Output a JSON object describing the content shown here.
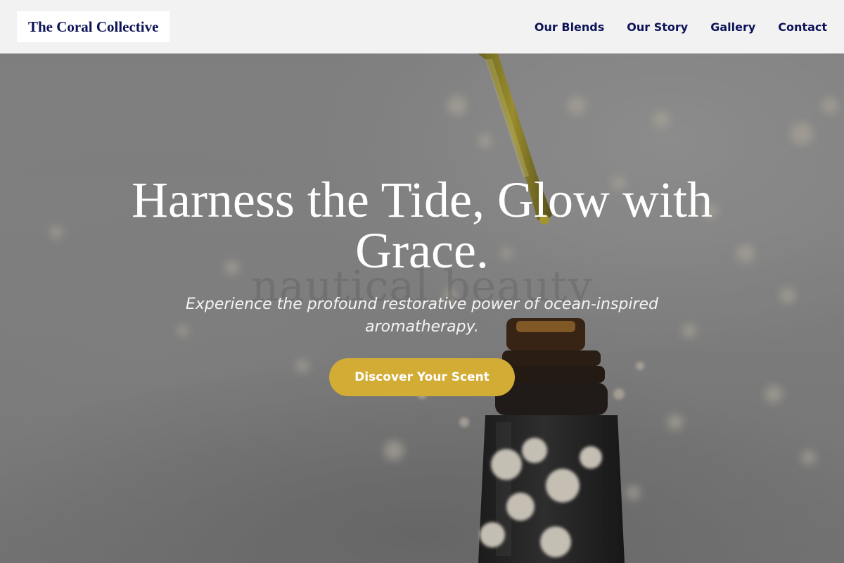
{
  "brand": {
    "name": "The Coral Collective"
  },
  "nav": {
    "items": [
      {
        "label": "Our Blends"
      },
      {
        "label": "Our Story"
      },
      {
        "label": "Gallery"
      },
      {
        "label": "Contact"
      }
    ]
  },
  "hero": {
    "title": "Harness the Tide, Glow with Grace.",
    "subtitle": "Experience the profound restorative power of ocean-inspired aromatherapy.",
    "cta_label": "Discover Your Scent",
    "watermark": "nautical beauty"
  },
  "colors": {
    "header_bg": "#f2f2f2",
    "brand_text": "#0b1257",
    "cta_bg": "#d2ac35",
    "hero_text": "#ffffff"
  }
}
